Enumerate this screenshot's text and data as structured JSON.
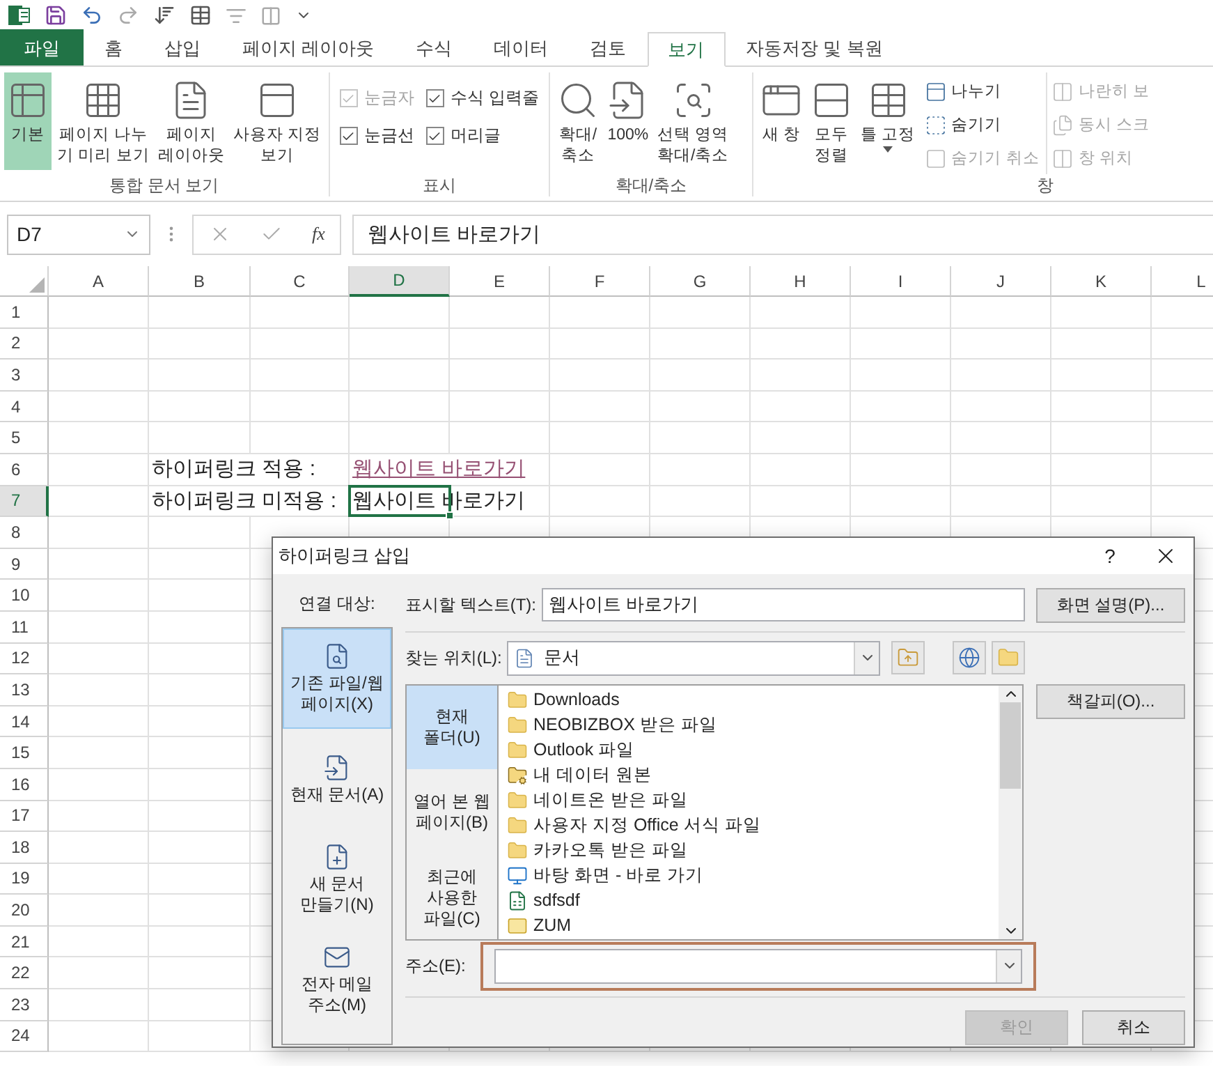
{
  "tabs": [
    {
      "label": "파일",
      "kind": "file",
      "selected": false
    },
    {
      "label": "홈",
      "kind": "tab",
      "selected": false
    },
    {
      "label": "삽입",
      "kind": "tab",
      "selected": false
    },
    {
      "label": "페이지 레이아웃",
      "kind": "tab",
      "selected": false
    },
    {
      "label": "수식",
      "kind": "tab",
      "selected": false
    },
    {
      "label": "데이터",
      "kind": "tab",
      "selected": false
    },
    {
      "label": "검토",
      "kind": "tab",
      "selected": false
    },
    {
      "label": "보기",
      "kind": "tab",
      "selected": true
    },
    {
      "label": "자동저장 및 복원",
      "kind": "tab",
      "selected": false
    }
  ],
  "ribbon": {
    "groups": [
      {
        "label": "통합 문서 보기",
        "items": [
          {
            "kind": "large",
            "label": "기본",
            "selected": true
          },
          {
            "kind": "large",
            "label": "페이지 나누\n기 미리 보기",
            "selected": false
          },
          {
            "kind": "large",
            "label": "페이지\n레이아웃",
            "selected": false
          },
          {
            "kind": "large",
            "label": "사용자 지정\n보기",
            "selected": false
          }
        ]
      },
      {
        "label": "표시",
        "items": [
          {
            "kind": "check",
            "label": "눈금자",
            "checked": true,
            "disabled": true
          },
          {
            "kind": "check",
            "label": "수식 입력줄",
            "checked": true,
            "disabled": false
          },
          {
            "kind": "check",
            "label": "눈금선",
            "checked": true,
            "disabled": false
          },
          {
            "kind": "check",
            "label": "머리글",
            "checked": true,
            "disabled": false
          }
        ]
      },
      {
        "label": "확대/축소",
        "items": [
          {
            "kind": "large",
            "label": "확대/\n축소"
          },
          {
            "kind": "large",
            "label": "100%"
          },
          {
            "kind": "large",
            "label": "선택 영역\n확대/축소"
          }
        ]
      },
      {
        "label": "창",
        "items": [
          {
            "kind": "large",
            "label": "새 창",
            "dropdown": false,
            "disabled": false
          },
          {
            "kind": "large",
            "label": "모두\n정렬",
            "dropdown": false,
            "disabled": false
          },
          {
            "kind": "large",
            "label": "틀 고정",
            "dropdown": true,
            "disabled": false
          },
          {
            "kind": "small",
            "label": "나누기",
            "dropdown": false,
            "disabled": false
          },
          {
            "kind": "small",
            "label": "숨기기",
            "dropdown": false,
            "disabled": false
          },
          {
            "kind": "small",
            "label": "숨기기 취소",
            "dropdown": false,
            "disabled": true
          },
          {
            "kind": "small",
            "label": "나란히 보",
            "dropdown": false,
            "disabled": true
          },
          {
            "kind": "small",
            "label": "동시 스크",
            "dropdown": false,
            "disabled": true
          },
          {
            "kind": "small",
            "label": "창 위치",
            "dropdown": false,
            "disabled": true
          }
        ]
      }
    ]
  },
  "formula_bar": {
    "name_box": "D7",
    "function_label": "fx",
    "formula": "웹사이트 바로가기"
  },
  "sheet": {
    "columns": [
      {
        "label": "A",
        "selected": false
      },
      {
        "label": "B",
        "selected": false
      },
      {
        "label": "C",
        "selected": false
      },
      {
        "label": "D",
        "selected": true
      },
      {
        "label": "E",
        "selected": false
      },
      {
        "label": "F",
        "selected": false
      },
      {
        "label": "G",
        "selected": false
      },
      {
        "label": "H",
        "selected": false
      },
      {
        "label": "I",
        "selected": false
      },
      {
        "label": "J",
        "selected": false
      },
      {
        "label": "K",
        "selected": false
      },
      {
        "label": "L",
        "selected": false
      }
    ],
    "rows": [
      {
        "label": "1",
        "selected": false
      },
      {
        "label": "2",
        "selected": false
      },
      {
        "label": "3",
        "selected": false
      },
      {
        "label": "4",
        "selected": false
      },
      {
        "label": "5",
        "selected": false
      },
      {
        "label": "6",
        "selected": false,
        "caption": "하이퍼링크 적용 :",
        "value": {
          "text": "웹사이트 바로가기",
          "kind": "link",
          "selected": false
        }
      },
      {
        "label": "7",
        "selected": true,
        "caption": "하이퍼링크 미적용 :",
        "value": {
          "text": "웹사이트 바로가기",
          "kind": "plain",
          "selected": true
        }
      },
      {
        "label": "8",
        "selected": false
      },
      {
        "label": "9",
        "selected": false
      },
      {
        "label": "10",
        "selected": false
      },
      {
        "label": "11",
        "selected": false
      },
      {
        "label": "12",
        "selected": false
      },
      {
        "label": "13",
        "selected": false
      },
      {
        "label": "14",
        "selected": false
      },
      {
        "label": "15",
        "selected": false
      },
      {
        "label": "16",
        "selected": false
      },
      {
        "label": "17",
        "selected": false
      },
      {
        "label": "18",
        "selected": false
      },
      {
        "label": "19",
        "selected": false
      },
      {
        "label": "20",
        "selected": false
      },
      {
        "label": "21",
        "selected": false
      },
      {
        "label": "22",
        "selected": false
      },
      {
        "label": "23",
        "selected": false
      },
      {
        "label": "24",
        "selected": false
      }
    ]
  },
  "dialog": {
    "title": "하이퍼링크 삽입",
    "help": "?",
    "link_to_label": "연결 대상:",
    "link_targets": [
      {
        "label": "기존 파일/웹\n페이지(X)",
        "selected": true
      },
      {
        "label": "현재 문서(A)",
        "selected": false
      },
      {
        "label": "새 문서\n만들기(N)",
        "selected": false
      },
      {
        "label": "전자 메일\n주소(M)",
        "selected": false
      }
    ],
    "display_text": {
      "label": "표시할 텍스트(T):",
      "value": "웹사이트 바로가기"
    },
    "screen_tip_button": "화면 설명(P)...",
    "look_in": {
      "label": "찾는 위치(L):",
      "value": "문서"
    },
    "browse_sections": [
      {
        "label": "현재\n폴더(U)",
        "selected": true
      },
      {
        "label": "열어 본 웹\n페이지(B)",
        "selected": false
      },
      {
        "label": "최근에\n사용한\n파일(C)",
        "selected": false
      }
    ],
    "files": [
      {
        "name": "Downloads",
        "kind": "folder"
      },
      {
        "name": "NEOBIZBOX 받은 파일",
        "kind": "folder"
      },
      {
        "name": "Outlook 파일",
        "kind": "folder"
      },
      {
        "name": "내 데이터 원본",
        "kind": "data_folder"
      },
      {
        "name": "네이트온 받은 파일",
        "kind": "folder"
      },
      {
        "name": "사용자 지정 Office 서식 파일",
        "kind": "folder"
      },
      {
        "name": "카카오톡 받은 파일",
        "kind": "folder"
      },
      {
        "name": "바탕 화면 - 바로 가기",
        "kind": "shortcut"
      },
      {
        "name": "sdfsdf",
        "kind": "excel"
      },
      {
        "name": "ZUM",
        "kind": "mail"
      }
    ],
    "bookmark_button": "책갈피(O)...",
    "address": {
      "label": "주소(E):",
      "highlighted": true
    },
    "buttons": [
      {
        "label": "확인",
        "disabled": true
      },
      {
        "label": "취소",
        "disabled": false
      }
    ]
  }
}
